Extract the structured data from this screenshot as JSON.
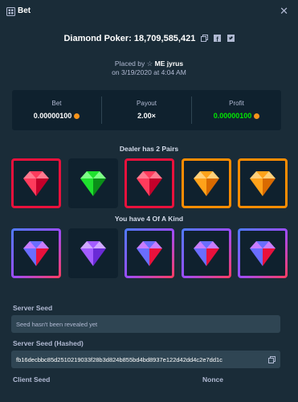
{
  "header": {
    "title": "Bet",
    "close_icon": "close-icon"
  },
  "game": {
    "name": "Diamond Poker:",
    "bet_id": "18,709,585,421"
  },
  "placed": {
    "by_text": "Placed by",
    "user": "ME jyrus",
    "on_text": "on 3/19/2020 at 4:04 AM"
  },
  "stats": [
    {
      "label": "Bet",
      "value": "0.00000100",
      "coin": true,
      "color": "#ffffff"
    },
    {
      "label": "Payout",
      "value": "2.00×",
      "coin": false,
      "color": "#ffffff"
    },
    {
      "label": "Profit",
      "value": "0.00000100",
      "coin": true,
      "color": "#00e701"
    }
  ],
  "dealer": {
    "result_text": "Dealer has 2 Pairs",
    "gems": [
      {
        "gem": "red",
        "frame": "red"
      },
      {
        "gem": "green",
        "frame": "plain"
      },
      {
        "gem": "red",
        "frame": "red"
      },
      {
        "gem": "orange",
        "frame": "orange"
      },
      {
        "gem": "orange",
        "frame": "orange"
      }
    ]
  },
  "player": {
    "result_text": "You have 4 Of A Kind",
    "gems": [
      {
        "gem": "multi",
        "frame": "rainbow"
      },
      {
        "gem": "purple",
        "frame": "plain"
      },
      {
        "gem": "multi",
        "frame": "rainbow"
      },
      {
        "gem": "multi",
        "frame": "rainbow"
      },
      {
        "gem": "multi",
        "frame": "rainbow"
      }
    ]
  },
  "server_seed": {
    "label": "Server Seed",
    "value": "Seed hasn't been revealed yet"
  },
  "server_seed_hashed": {
    "label": "Server Seed (Hashed)",
    "value": "fb16decbbc85d2510219033f28b3d824b855bd4bd8937e122d42dd4c2e7dd1c"
  },
  "client_seed": {
    "label": "Client Seed"
  },
  "nonce": {
    "label": "Nonce"
  },
  "colors": {
    "background": "#1a2c38",
    "panel": "#0f212e",
    "input": "#2f4553",
    "green": "#00e701",
    "red": "#e9113c",
    "orange": "#ff8c00"
  }
}
